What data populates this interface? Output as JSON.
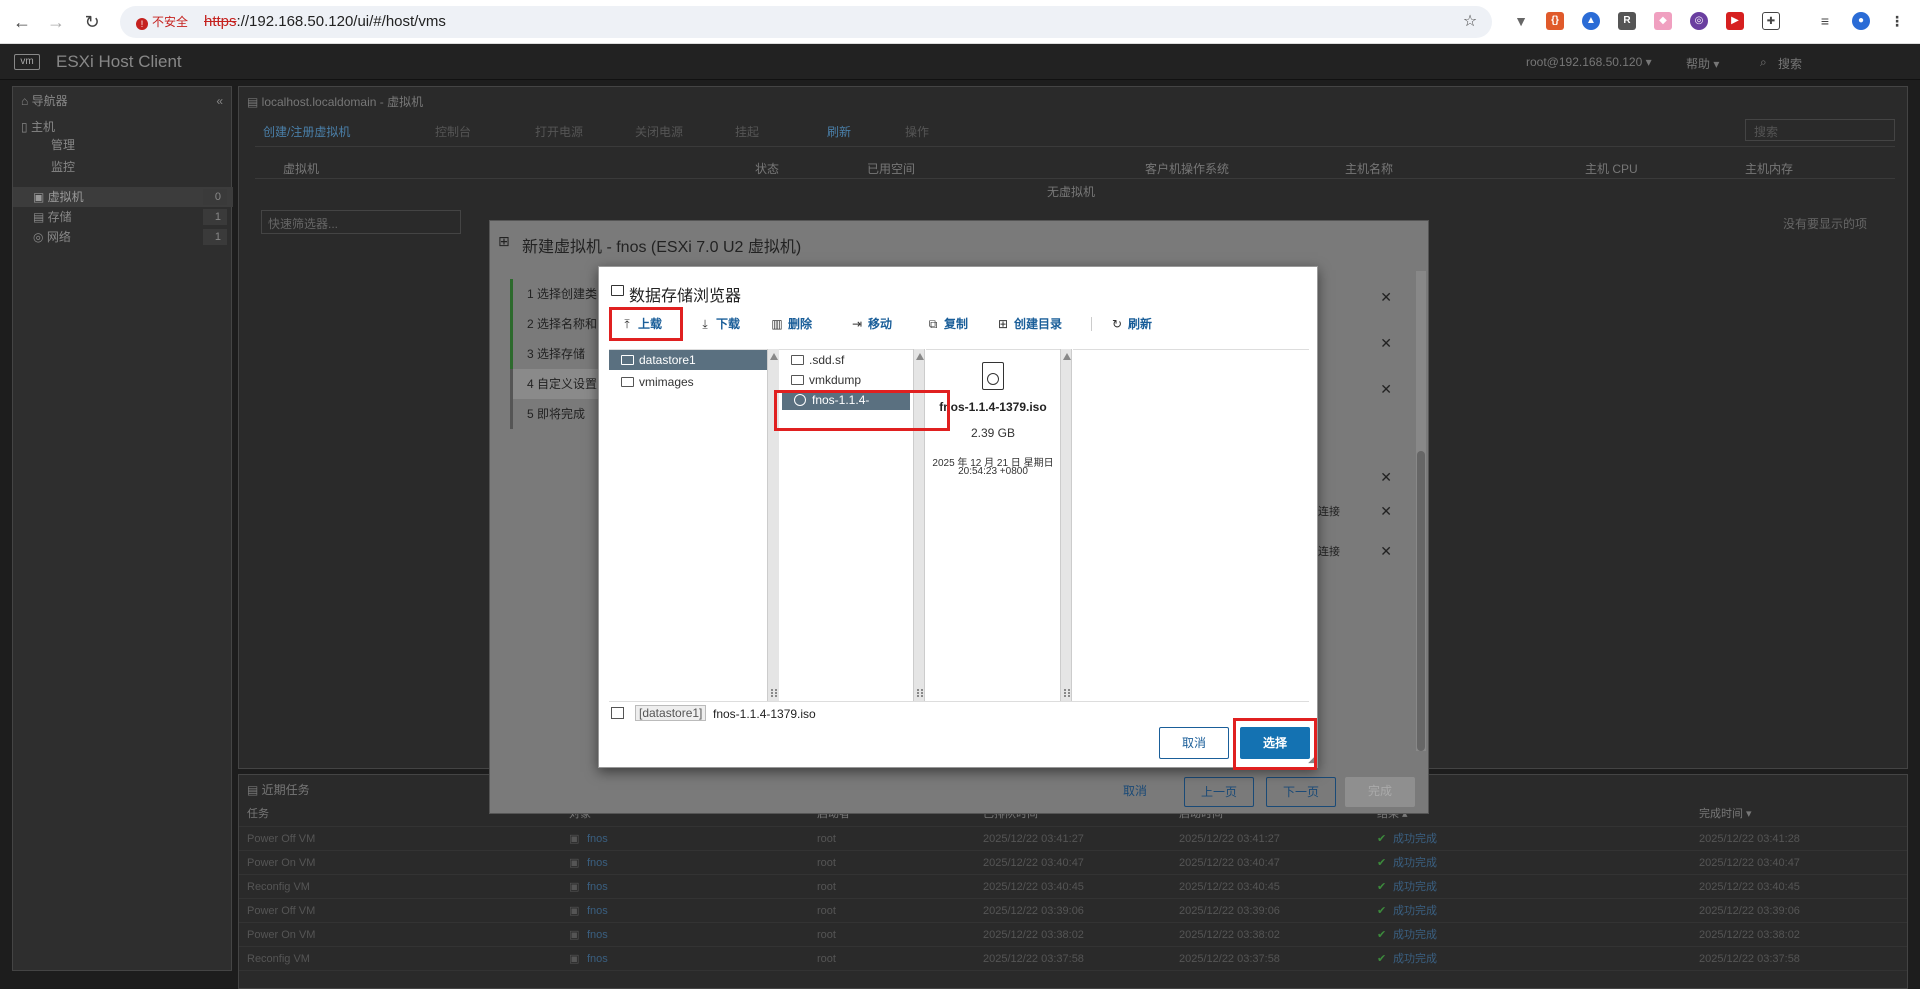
{
  "browser": {
    "security_label": "不安全",
    "url_scheme": "https",
    "url_rest": "://192.168.50.120/ui/#/host/vms"
  },
  "app": {
    "title": "ESXi Host Client",
    "user": "root@192.168.50.120 ▾",
    "help": "帮助 ▾",
    "search": "搜索"
  },
  "sidebar": {
    "navigator": "导航器",
    "host": "主机",
    "manage": "管理",
    "monitor": "监控",
    "vms": "虚拟机",
    "vms_count": "0",
    "storage": "存储",
    "storage_count": "1",
    "network": "网络",
    "network_count": "1"
  },
  "main": {
    "breadcrumb": "localhost.localdomain - 虚拟机",
    "toolbar": [
      "创建/注册虚拟机",
      "控制台",
      "打开电源",
      "关闭电源",
      "挂起",
      "刷新",
      "操作"
    ],
    "search_placeholder": "搜索",
    "columns": [
      "虚拟机",
      "状态",
      "已用空间",
      "客户机操作系统",
      "主机名称",
      "主机 CPU",
      "主机内存"
    ],
    "empty": "无虚拟机",
    "filter_placeholder": "快速筛选器...",
    "no_items": "没有要显示的项"
  },
  "tasks": {
    "title": "近期任务",
    "columns": [
      "任务",
      "对象",
      "启动者",
      "已排队时间",
      "启动时间",
      "结果 ▴",
      "完成时间 ▾"
    ],
    "rows": [
      {
        "task": "Power Off VM",
        "target": "fnos",
        "initiator": "root",
        "queued": "2025/12/22 03:41:27",
        "started": "2025/12/22 03:41:27",
        "result": "成功完成",
        "completed": "2025/12/22 03:41:28"
      },
      {
        "task": "Power On VM",
        "target": "fnos",
        "initiator": "root",
        "queued": "2025/12/22 03:40:47",
        "started": "2025/12/22 03:40:47",
        "result": "成功完成",
        "completed": "2025/12/22 03:40:47"
      },
      {
        "task": "Reconfig VM",
        "target": "fnos",
        "initiator": "root",
        "queued": "2025/12/22 03:40:45",
        "started": "2025/12/22 03:40:45",
        "result": "成功完成",
        "completed": "2025/12/22 03:40:45"
      },
      {
        "task": "Power Off VM",
        "target": "fnos",
        "initiator": "root",
        "queued": "2025/12/22 03:39:06",
        "started": "2025/12/22 03:39:06",
        "result": "成功完成",
        "completed": "2025/12/22 03:39:06"
      },
      {
        "task": "Power On VM",
        "target": "fnos",
        "initiator": "root",
        "queued": "2025/12/22 03:38:02",
        "started": "2025/12/22 03:38:02",
        "result": "成功完成",
        "completed": "2025/12/22 03:38:02"
      },
      {
        "task": "Reconfig VM",
        "target": "fnos",
        "initiator": "root",
        "queued": "2025/12/22 03:37:58",
        "started": "2025/12/22 03:37:58",
        "result": "成功完成",
        "completed": "2025/12/22 03:37:58"
      }
    ]
  },
  "wizard": {
    "title": "新建虚拟机 - fnos (ESXi 7.0 U2 虚拟机)",
    "steps": [
      "1 选择创建类",
      "2 选择名称和",
      "3 选择存储",
      "4 自定义设置",
      "5 即将完成"
    ],
    "connect1": "连接",
    "connect2": "连接",
    "buttons": {
      "cancel": "取消",
      "back": "上一页",
      "next": "下一页",
      "finish": "完成"
    }
  },
  "browser_dialog": {
    "title": "数据存储浏览器",
    "toolbar": {
      "upload": "上载",
      "download": "下载",
      "delete": "删除",
      "move": "移动",
      "copy": "复制",
      "mkdir": "创建目录",
      "refresh": "刷新"
    },
    "datastores": [
      "datastore1",
      "vmimages"
    ],
    "files": [
      ".sdd.sf",
      "vmkdump",
      "fnos-1.1.4-1379.iso"
    ],
    "detail": {
      "name": "fnos-1.1.4-1379.iso",
      "size": "2.39 GB",
      "date": "2025 年 12 月 21 日 星期日",
      "time": "20:54:23 +0800"
    },
    "path_ds": "[datastore1]",
    "path_file": "fnos-1.1.4-1379.iso",
    "cancel": "取消",
    "select": "选择"
  }
}
